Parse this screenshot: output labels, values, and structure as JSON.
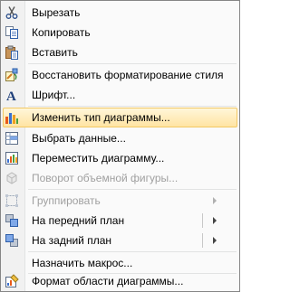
{
  "menu": {
    "cut": {
      "label": "Вырезать",
      "icon": "scissors-icon"
    },
    "copy": {
      "label": "Копировать",
      "icon": "copy-icon"
    },
    "paste": {
      "label": "Вставить",
      "icon": "paste-icon"
    },
    "reset_style": {
      "label": "Восстановить форматирование стиля",
      "icon": "reset-style-icon"
    },
    "font": {
      "label": "Шрифт...",
      "icon": "font-icon"
    },
    "change_chart_type": {
      "label": "Изменить тип диаграммы...",
      "icon": "chart-type-icon",
      "highlighted": true
    },
    "select_data": {
      "label": "Выбрать данные...",
      "icon": "select-data-icon"
    },
    "move_chart": {
      "label": "Переместить диаграмму...",
      "icon": "move-chart-icon"
    },
    "rotate_3d": {
      "label": "Поворот объемной фигуры...",
      "icon": "rotate-3d-icon",
      "disabled": true
    },
    "group": {
      "label": "Группировать",
      "icon": "group-icon",
      "disabled": true
    },
    "bring_front": {
      "label": "На передний план",
      "icon": "bring-front-icon"
    },
    "send_back": {
      "label": "На задний план",
      "icon": "send-back-icon"
    },
    "assign_macro": {
      "label": "Назначить макрос..."
    },
    "format_chart_area": {
      "label": "Формат области диаграммы...",
      "icon": "format-area-icon"
    }
  },
  "colors": {
    "highlight_top": "#fff6d9",
    "highlight_bottom": "#ffe4a3",
    "highlight_border": "#f2c864",
    "disabled_text": "#a0a0a0"
  }
}
